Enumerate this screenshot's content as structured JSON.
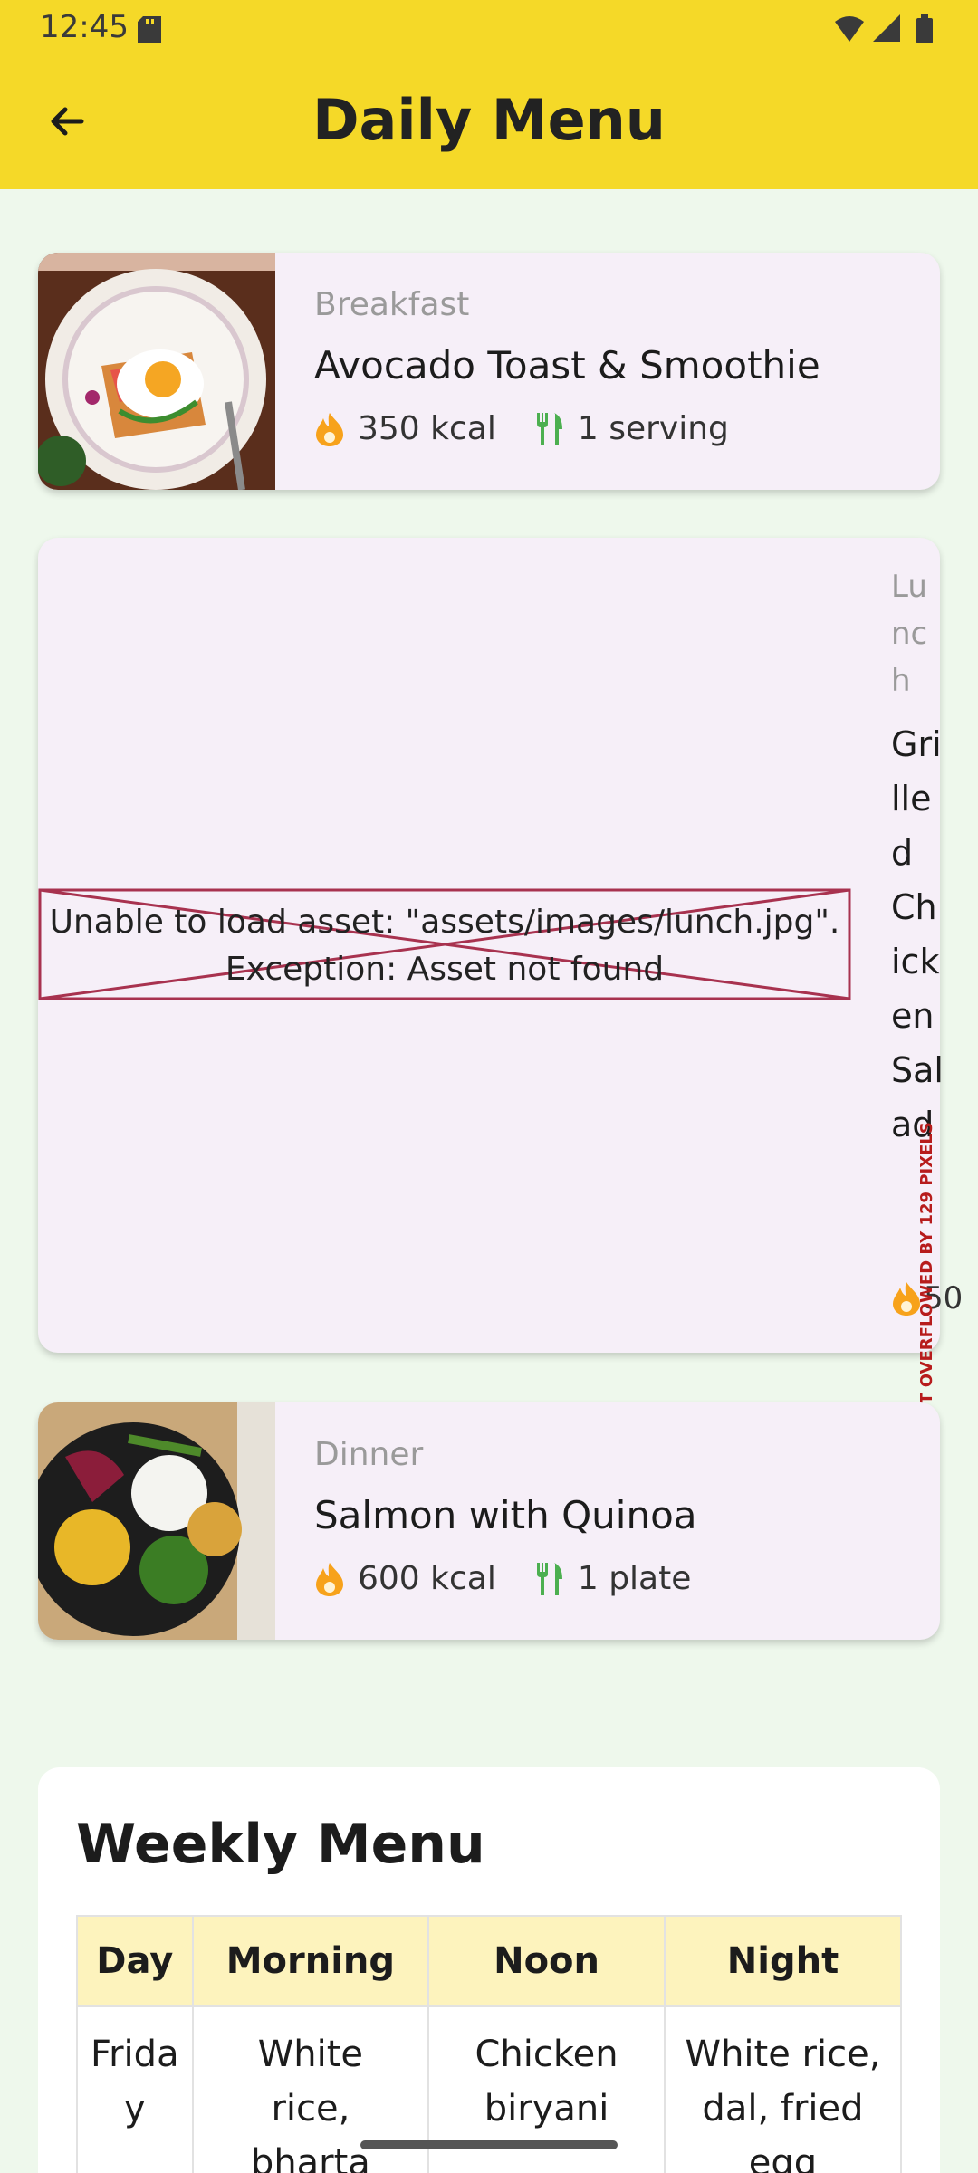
{
  "status_bar": {
    "time": "12:45"
  },
  "app_bar": {
    "title": "Daily Menu"
  },
  "meals": [
    {
      "type": "Breakfast",
      "name": "Avocado Toast & Smoothie",
      "kcal": "350 kcal",
      "portion": "1 serving"
    },
    {
      "type": "Lunch",
      "name": "Grilled Chicken Salad",
      "kcal": "50",
      "error_line1": "Unable to load asset: \"assets/images/lunch.jpg\".",
      "error_line2": "Exception: Asset not found"
    },
    {
      "type": "Dinner",
      "name": "Salmon with Quinoa",
      "kcal": "600 kcal",
      "portion": "1 plate"
    }
  ],
  "overflow_label": "T OVERFLOWED BY 129 PIXELS",
  "weekly": {
    "title": "Weekly Menu",
    "headers": [
      "Day",
      "Morning",
      "Noon",
      "Night"
    ],
    "rows": [
      [
        "Friday",
        "White rice, bharta",
        "Chicken biryani",
        "White rice, dal, fried egg"
      ]
    ]
  },
  "colors": {
    "accent": "#f5d928",
    "card": "#f6eff8",
    "background": "#eef8ec",
    "kcal_icon": "#f7a21b",
    "utensil_icon": "#4caf50"
  },
  "icons": {
    "back": "arrow-left-icon",
    "kcal": "flame-icon",
    "portion": "utensils-icon"
  }
}
